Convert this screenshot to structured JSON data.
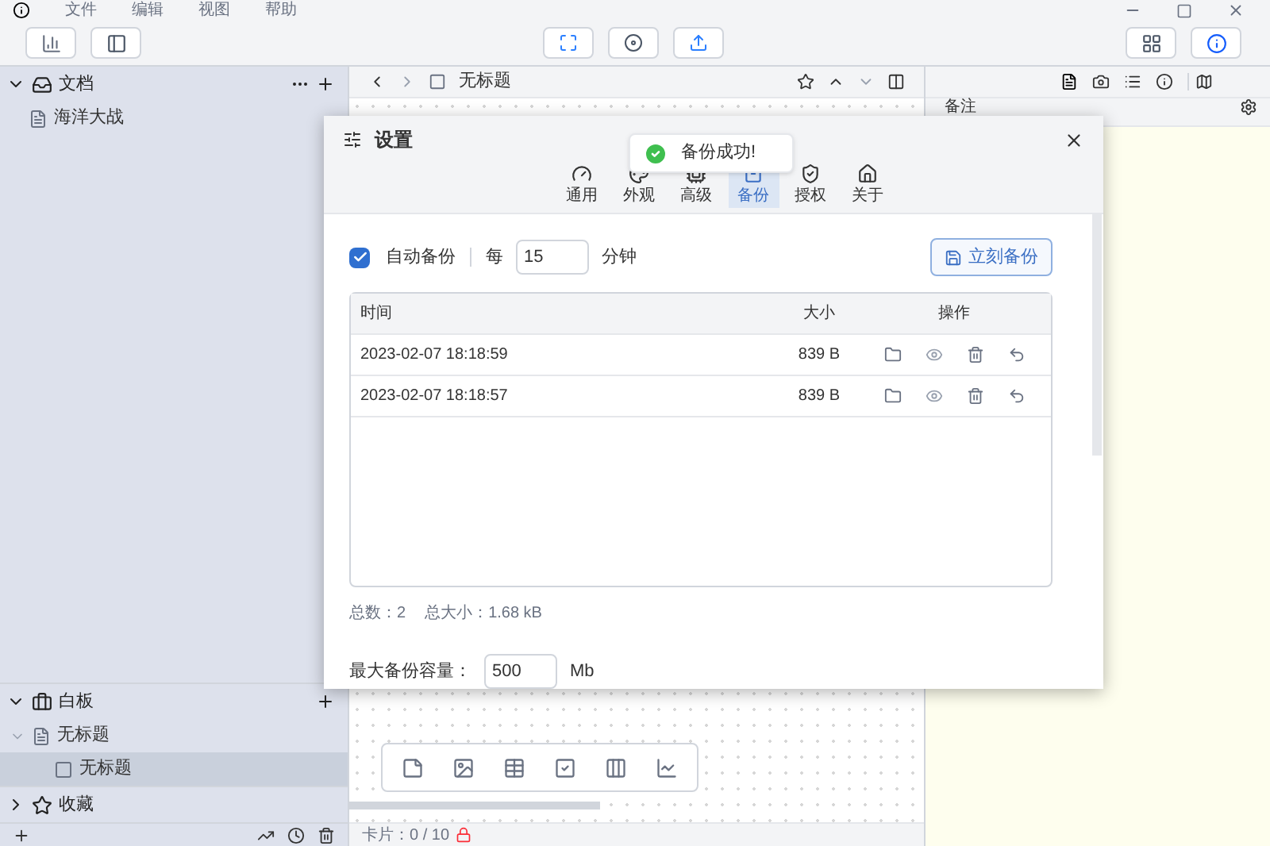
{
  "menu": [
    "文件",
    "编辑",
    "视图",
    "帮助"
  ],
  "sidebar": {
    "sections": [
      {
        "kind": "docs",
        "title": "文档",
        "expanded": true,
        "children": [
          {
            "label": "海洋大战",
            "selected": false
          }
        ]
      },
      {
        "kind": "board",
        "title": "白板",
        "expanded": true,
        "children": [
          {
            "label": "无标题",
            "selected": false,
            "expanded": true,
            "children": [
              {
                "label": "无标题",
                "selected": true
              }
            ]
          }
        ]
      },
      {
        "kind": "favorites",
        "title": "收藏",
        "expanded": false
      }
    ]
  },
  "editor": {
    "title": "无标题",
    "status": "卡片：0 / 10"
  },
  "notes": {
    "title": "备注"
  },
  "dialog": {
    "title": "设置",
    "tabs": [
      {
        "kind": "general",
        "label": "通用",
        "selected": false
      },
      {
        "kind": "look",
        "label": "外观",
        "selected": false
      },
      {
        "kind": "advanced",
        "label": "高级",
        "selected": false
      },
      {
        "kind": "backup",
        "label": "备份",
        "selected": true
      },
      {
        "kind": "license",
        "label": "授权",
        "selected": false
      },
      {
        "kind": "about",
        "label": "关于",
        "selected": false
      }
    ],
    "toast": "备份成功!",
    "auto_backup": {
      "label": "自动备份",
      "checked": true
    },
    "every": "每",
    "interval": "15",
    "unit": "分钟",
    "backup_button": "立刻备份",
    "table": {
      "columns": [
        "时间",
        "大小",
        "操作"
      ],
      "rows": [
        {
          "time": "2023-02-07 18:18:59",
          "size": "839 B"
        },
        {
          "time": "2023-02-07 18:18:57",
          "size": "839 B"
        }
      ]
    },
    "count": "总数：2",
    "total": "总大小：1.68 kB",
    "max_label": "最大备份容量：",
    "max_value": "500",
    "max_unit": "Mb"
  }
}
